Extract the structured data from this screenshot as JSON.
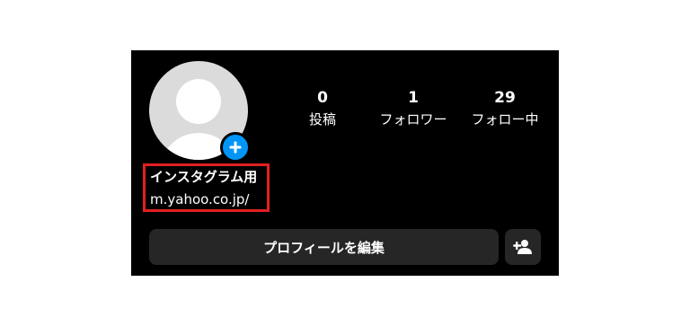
{
  "profile": {
    "avatar_icon": "default-avatar-icon",
    "add_story_icon": "plus-icon",
    "display_name": "インスタグラム用",
    "bio_link": "m.yahoo.co.jp/"
  },
  "stats": [
    {
      "value": "0",
      "label": "投稿"
    },
    {
      "value": "1",
      "label": "フォロワー"
    },
    {
      "value": "29",
      "label": "フォロー中"
    }
  ],
  "actions": {
    "edit_profile_label": "プロフィールを編集",
    "suggest_icon": "add-person-icon"
  },
  "colors": {
    "background": "#000000",
    "button": "#262626",
    "accent": "#0095f6",
    "highlight_box": "#e0201f"
  }
}
